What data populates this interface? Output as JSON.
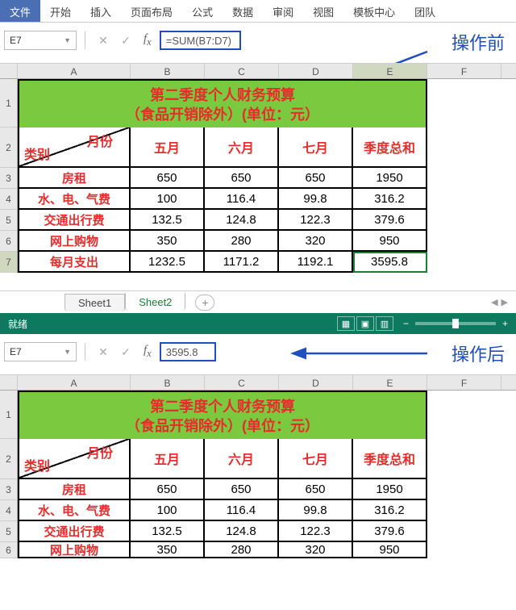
{
  "ribbon": {
    "tabs": [
      "文件",
      "开始",
      "插入",
      "页面布局",
      "公式",
      "数据",
      "审阅",
      "视图",
      "模板中心",
      "团队"
    ],
    "active_index": 0
  },
  "before": {
    "name_box": "E7",
    "formula": "=SUM(B7:D7)",
    "annotation": "操作前"
  },
  "after": {
    "name_box": "E7",
    "formula": "3595.8",
    "annotation": "操作后"
  },
  "columns": [
    "A",
    "B",
    "C",
    "D",
    "E",
    "F"
  ],
  "sheet": {
    "title_l1": "第二季度个人财务预算",
    "title_l2": "（食品开销除外）(单位：元）",
    "diag_top": "月份",
    "diag_bot": "类别",
    "headers": [
      "五月",
      "六月",
      "七月",
      "季度总和"
    ],
    "rows": [
      {
        "label": "房租",
        "cells": [
          "650",
          "650",
          "650",
          "1950"
        ]
      },
      {
        "label": "水、电、气费",
        "cells": [
          "100",
          "116.4",
          "99.8",
          "316.2"
        ]
      },
      {
        "label": "交通出行费",
        "cells": [
          "132.5",
          "124.8",
          "122.3",
          "379.6"
        ]
      },
      {
        "label": "网上购物",
        "cells": [
          "350",
          "280",
          "320",
          "950"
        ]
      },
      {
        "label": "每月支出",
        "cells": [
          "1232.5",
          "1171.2",
          "1192.1",
          "3595.8"
        ]
      }
    ]
  },
  "sheets": {
    "tabs": [
      "Sheet1",
      "Sheet2"
    ],
    "active": 1
  },
  "status": {
    "ready": "就绪"
  },
  "chart_data": {
    "type": "table",
    "title": "第二季度个人财务预算（食品开销除外）(单位：元）",
    "columns": [
      "类别",
      "五月",
      "六月",
      "七月",
      "季度总和"
    ],
    "rows": [
      [
        "房租",
        650,
        650,
        650,
        1950
      ],
      [
        "水、电、气费",
        100,
        116.4,
        99.8,
        316.2
      ],
      [
        "交通出行费",
        132.5,
        124.8,
        122.3,
        379.6
      ],
      [
        "网上购物",
        350,
        280,
        320,
        950
      ],
      [
        "每月支出",
        1232.5,
        1171.2,
        1192.1,
        3595.8
      ]
    ]
  }
}
